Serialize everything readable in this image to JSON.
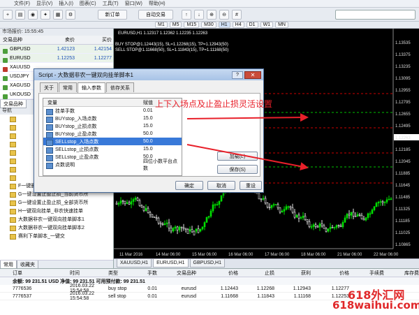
{
  "menu": [
    "文件(F)",
    "显示(V)",
    "插入(I)",
    "图表(C)",
    "工具(T)",
    "窗口(W)",
    "帮助(H)"
  ],
  "toolbar": {
    "new_order": "新订单",
    "auto_trading": "自动交易",
    "timeframes": [
      "M1",
      "M5",
      "M15",
      "M30",
      "H1",
      "H4",
      "D1",
      "W1",
      "MN"
    ]
  },
  "market_watch": {
    "title": "市场报价: 15:55:45",
    "headers": [
      "交易品种",
      "卖价",
      "买价"
    ],
    "rows": [
      {
        "symbol": "GBPUSD",
        "bid": "1.42123",
        "ask": "1.42154",
        "color": "green"
      },
      {
        "symbol": "EURUSD",
        "bid": "1.12253",
        "ask": "1.12277",
        "color": "green"
      },
      {
        "symbol": "XAUUSD",
        "bid": "",
        "ask": "",
        "color": "red"
      },
      {
        "symbol": "USDJPY",
        "bid": "",
        "ask": "",
        "color": "green"
      },
      {
        "symbol": "XAGUSD",
        "bid": "",
        "ask": "",
        "color": "green"
      },
      {
        "symbol": "UKOUSD",
        "bid": "",
        "ask": "",
        "color": "green"
      }
    ],
    "tab": "交易品种"
  },
  "navigator": {
    "title": "导航",
    "items": [
      "F一键删单包括持仓单及挂单",
      "G一键设置止盈止损_当前货币所",
      "G一键设置止盈止损_全部货币所",
      "H一键双向挂单_非农快速挂单",
      "大数据非农一键双向挂单脚本1",
      "大数据非农一键双向挂单脚本2",
      "赛利下单脚本_一键交"
    ],
    "tabs": [
      "常用",
      "收藏夹"
    ]
  },
  "chart": {
    "title": "EURUSD,H1 1.12317 1.12362 1.12235 1.12263",
    "line1": "BUY STOP@1.12443(15), SL=1.12268(15), TP=1.12943(50)",
    "line2": "SELL STOP@1.11668(50), SL=1.11843(15), TP=1.11168(50)",
    "price_labels": [
      "1.13535",
      "1.13375",
      "1.13235",
      "1.13095",
      "1.12955",
      "1.12795",
      "1.12655",
      "1.12495",
      "1.12263",
      "1.12185",
      "1.12045",
      "1.11885",
      "1.11645",
      "1.11485",
      "1.11325",
      "1.11185",
      "1.11025",
      "1.10865"
    ],
    "current_price": "1.12263",
    "time_labels": [
      "11 Mar 2016",
      "14 Mar 06:00",
      "15 Mar 06:00",
      "16 Mar 06:00",
      "17 Mar 06:00",
      "18 Mar 06:00",
      "21 Mar 06:00",
      "22 Mar 06:00"
    ],
    "tabs": [
      "XAUUSD,H1",
      "EURUSD,H1",
      "GBPUSD,H1"
    ]
  },
  "dialog": {
    "title": "Script - 大数据非农一键双向挂单脚本1",
    "question": "?",
    "close": "✕",
    "tabs": [
      "关于",
      "常用",
      "输入参数",
      "依存关系"
    ],
    "headers": [
      "变量",
      "赋值"
    ],
    "params": [
      {
        "name": "挂单手数",
        "value": "0.01"
      },
      {
        "name": "BUYstop_入场点数",
        "value": "15.0"
      },
      {
        "name": "BUYstop_止损点数",
        "value": "15.0"
      },
      {
        "name": "BUYstop_止盈点数",
        "value": "50.0"
      },
      {
        "name": "SELLstop_入场点数",
        "value": "50.0"
      },
      {
        "name": "SELLstop_止损点数",
        "value": "15.0"
      },
      {
        "name": "SELLstop_止盈点数",
        "value": "50.0"
      },
      {
        "name": "点数说明",
        "value": "四位小数平台点数"
      }
    ],
    "load": "加载(L)",
    "save": "保存(S)",
    "ok": "确定",
    "cancel": "取消",
    "reset": "重设"
  },
  "annotation": "上下入场点及止盈止损灵活设置",
  "terminal": {
    "headers": [
      "订单",
      "时间",
      "类型",
      "手数",
      "交易品种",
      "价格",
      "止损",
      "获利",
      "价格",
      "手续费",
      "库存费"
    ],
    "balance": "余额: 99 231.51 USD  净值: 99 231.51  可用预付款: 99 231.51",
    "rows": [
      {
        "order": "7776536",
        "time": "2016.03.22 15:54:58",
        "type": "buy stop",
        "lots": "0.01",
        "symbol": "eurusd",
        "price": "1.12443",
        "sl": "1.12268",
        "tp": "1.12943",
        "cur": "1.12277"
      },
      {
        "order": "7776537",
        "time": "2016.03.22 15:54:58",
        "type": "sell stop",
        "lots": "0.01",
        "symbol": "eurusd",
        "price": "1.11668",
        "sl": "1.11843",
        "tp": "1.11168",
        "cur": "1.12253"
      }
    ]
  },
  "watermark": {
    "line1": "618外汇网",
    "line2": "618waihui.com"
  }
}
